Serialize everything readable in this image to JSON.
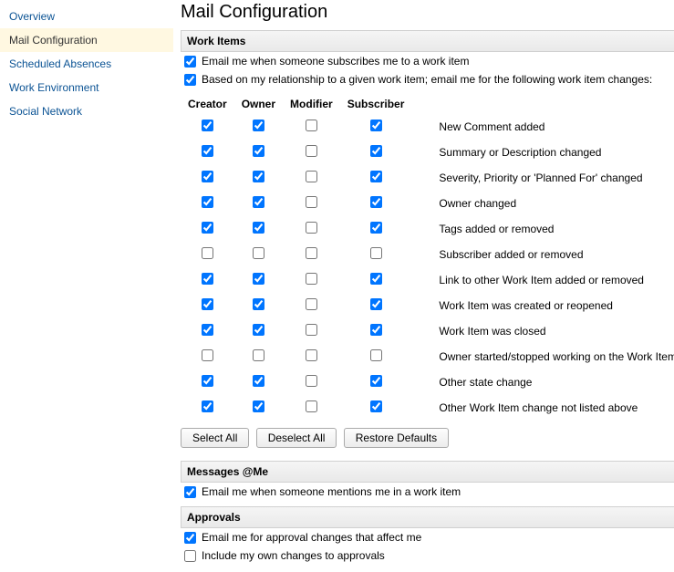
{
  "sidebar": {
    "items": [
      {
        "label": "Overview",
        "active": false
      },
      {
        "label": "Mail Configuration",
        "active": true
      },
      {
        "label": "Scheduled Absences",
        "active": false
      },
      {
        "label": "Work Environment",
        "active": false
      },
      {
        "label": "Social Network",
        "active": false
      }
    ]
  },
  "page": {
    "title": "Mail Configuration"
  },
  "sections": {
    "work_items": {
      "header": "Work Items",
      "opt_subscribe": {
        "label": "Email me when someone subscribes me to a work item",
        "checked": true
      },
      "opt_relationship": {
        "label": "Based on my relationship to a given work item; email me for the following work item changes:",
        "checked": true
      },
      "columns": [
        "Creator",
        "Owner",
        "Modifier",
        "Subscriber"
      ],
      "rows": [
        {
          "label": "New Comment added",
          "c": [
            true,
            true,
            false,
            true
          ]
        },
        {
          "label": "Summary or Description changed",
          "c": [
            true,
            true,
            false,
            true
          ]
        },
        {
          "label": "Severity, Priority or 'Planned For' changed",
          "c": [
            true,
            true,
            false,
            true
          ]
        },
        {
          "label": "Owner changed",
          "c": [
            true,
            true,
            false,
            true
          ]
        },
        {
          "label": "Tags added or removed",
          "c": [
            true,
            true,
            false,
            true
          ]
        },
        {
          "label": "Subscriber added or removed",
          "c": [
            false,
            false,
            false,
            false
          ]
        },
        {
          "label": "Link to other Work Item added or removed",
          "c": [
            true,
            true,
            false,
            true
          ]
        },
        {
          "label": "Work Item was created or reopened",
          "c": [
            true,
            true,
            false,
            true
          ]
        },
        {
          "label": "Work Item was closed",
          "c": [
            true,
            true,
            false,
            true
          ]
        },
        {
          "label": "Owner started/stopped working on the Work Item",
          "c": [
            false,
            false,
            false,
            false
          ]
        },
        {
          "label": "Other state change",
          "c": [
            true,
            true,
            false,
            true
          ]
        },
        {
          "label": "Other Work Item change not listed above",
          "c": [
            true,
            true,
            false,
            true
          ]
        }
      ],
      "buttons": {
        "select_all": "Select All",
        "deselect_all": "Deselect All",
        "restore": "Restore Defaults"
      }
    },
    "messages": {
      "header": "Messages @Me",
      "opt_mention": {
        "label": "Email me when someone mentions me in a work item",
        "checked": true
      }
    },
    "approvals": {
      "header": "Approvals",
      "opt_approval_changes": {
        "label": "Email me for approval changes that affect me",
        "checked": true
      },
      "opt_include_own": {
        "label": "Include my own changes to approvals",
        "checked": false
      }
    }
  }
}
